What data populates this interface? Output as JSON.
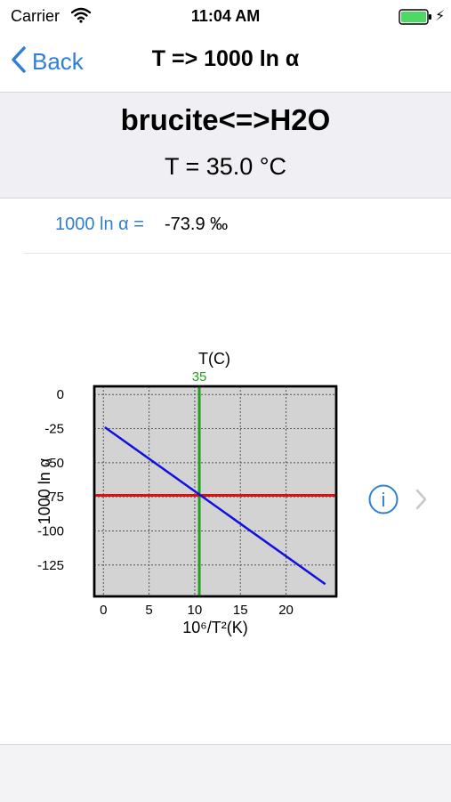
{
  "status_bar": {
    "carrier": "Carrier",
    "time": "11:04 AM",
    "battery_color": "#4cd964"
  },
  "nav": {
    "back_label": "Back",
    "title": "T => 1000 ln α",
    "accent_color": "#2f7fd6"
  },
  "header": {
    "reaction": "brucite<=>H2O",
    "temperature": "T = 35.0 °C"
  },
  "result": {
    "label": "1000 ln α =",
    "value": "-73.9 ‰"
  },
  "chart_data": {
    "type": "line",
    "top_label": "T(C)",
    "top_marker_label": "35",
    "xlabel": "10⁶/T²(K)",
    "ylabel": "1000 ln α",
    "x_ticks": [
      0,
      5,
      10,
      15,
      20
    ],
    "y_ticks": [
      0,
      -25,
      -50,
      -75,
      -100,
      -125
    ],
    "xlim": [
      -1,
      25.5
    ],
    "ylim": [
      -148,
      6
    ],
    "grid": true,
    "series": [
      {
        "color": "#1010e0",
        "x": [
          0.15,
          24.3
        ],
        "y": [
          -24,
          -139
        ]
      }
    ],
    "vertical_marker": {
      "x": 10.5,
      "color": "#22a022"
    },
    "horizontal_marker": {
      "y": -73.9,
      "color": "#e01010"
    }
  },
  "icons": {
    "back": "chevron-left-icon",
    "info": "info-icon",
    "disclosure": "chevron-right-icon",
    "wifi": "wifi-icon",
    "battery": "battery-icon",
    "charging": "bolt-icon"
  }
}
